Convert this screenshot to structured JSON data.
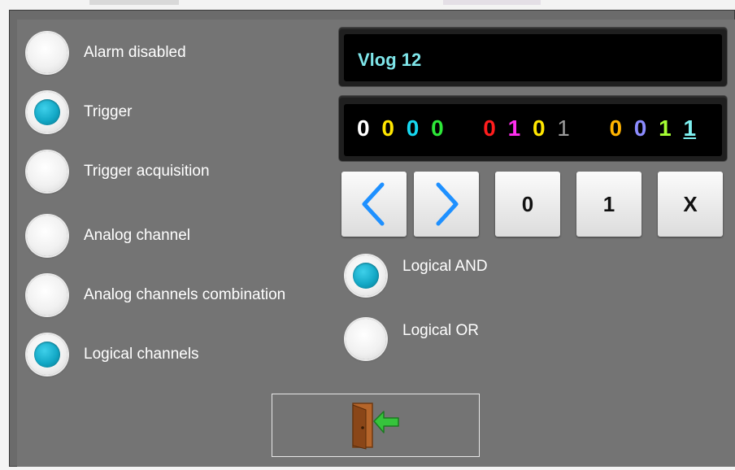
{
  "options": [
    {
      "label": "Alarm disabled",
      "checked": false
    },
    {
      "label": "Trigger",
      "checked": true
    },
    {
      "label": "Trigger acquisition",
      "checked": false
    },
    {
      "label": "Analog channel",
      "checked": false
    },
    {
      "label": "Analog channels combination",
      "checked": false
    },
    {
      "label": "Logical channels",
      "checked": true
    }
  ],
  "channel_name": "Vlog 12",
  "bits": [
    {
      "value": "0",
      "color": "#ffffff"
    },
    {
      "value": "0",
      "color": "#ffe600"
    },
    {
      "value": "0",
      "color": "#16d7f0"
    },
    {
      "value": "0",
      "color": "#2de838"
    },
    {
      "value": "0",
      "color": "#ff1d1d"
    },
    {
      "value": "1",
      "color": "#ff2ff0"
    },
    {
      "value": "0",
      "color": "#ffe600"
    },
    {
      "value": "1",
      "color": "#9c9c9c"
    },
    {
      "value": "0",
      "color": "#ffb300"
    },
    {
      "value": "0",
      "color": "#8c8cff"
    },
    {
      "value": "1",
      "color": "#a6ff33"
    },
    {
      "value": "1",
      "color": "#7ef0f0"
    }
  ],
  "buttons": {
    "prev": "prev",
    "next": "next",
    "zero": "0",
    "one": "1",
    "x": "X"
  },
  "logic_options": [
    {
      "label": "Logical AND",
      "checked": true
    },
    {
      "label": "Logical OR",
      "checked": false
    }
  ],
  "icons": {
    "exit": "exit-door-icon",
    "prev": "chevron-left-icon",
    "next": "chevron-right-icon"
  },
  "colors": {
    "accent": "#13a8c6",
    "chevron": "#1e90ff",
    "dialog_bg": "#747474"
  }
}
